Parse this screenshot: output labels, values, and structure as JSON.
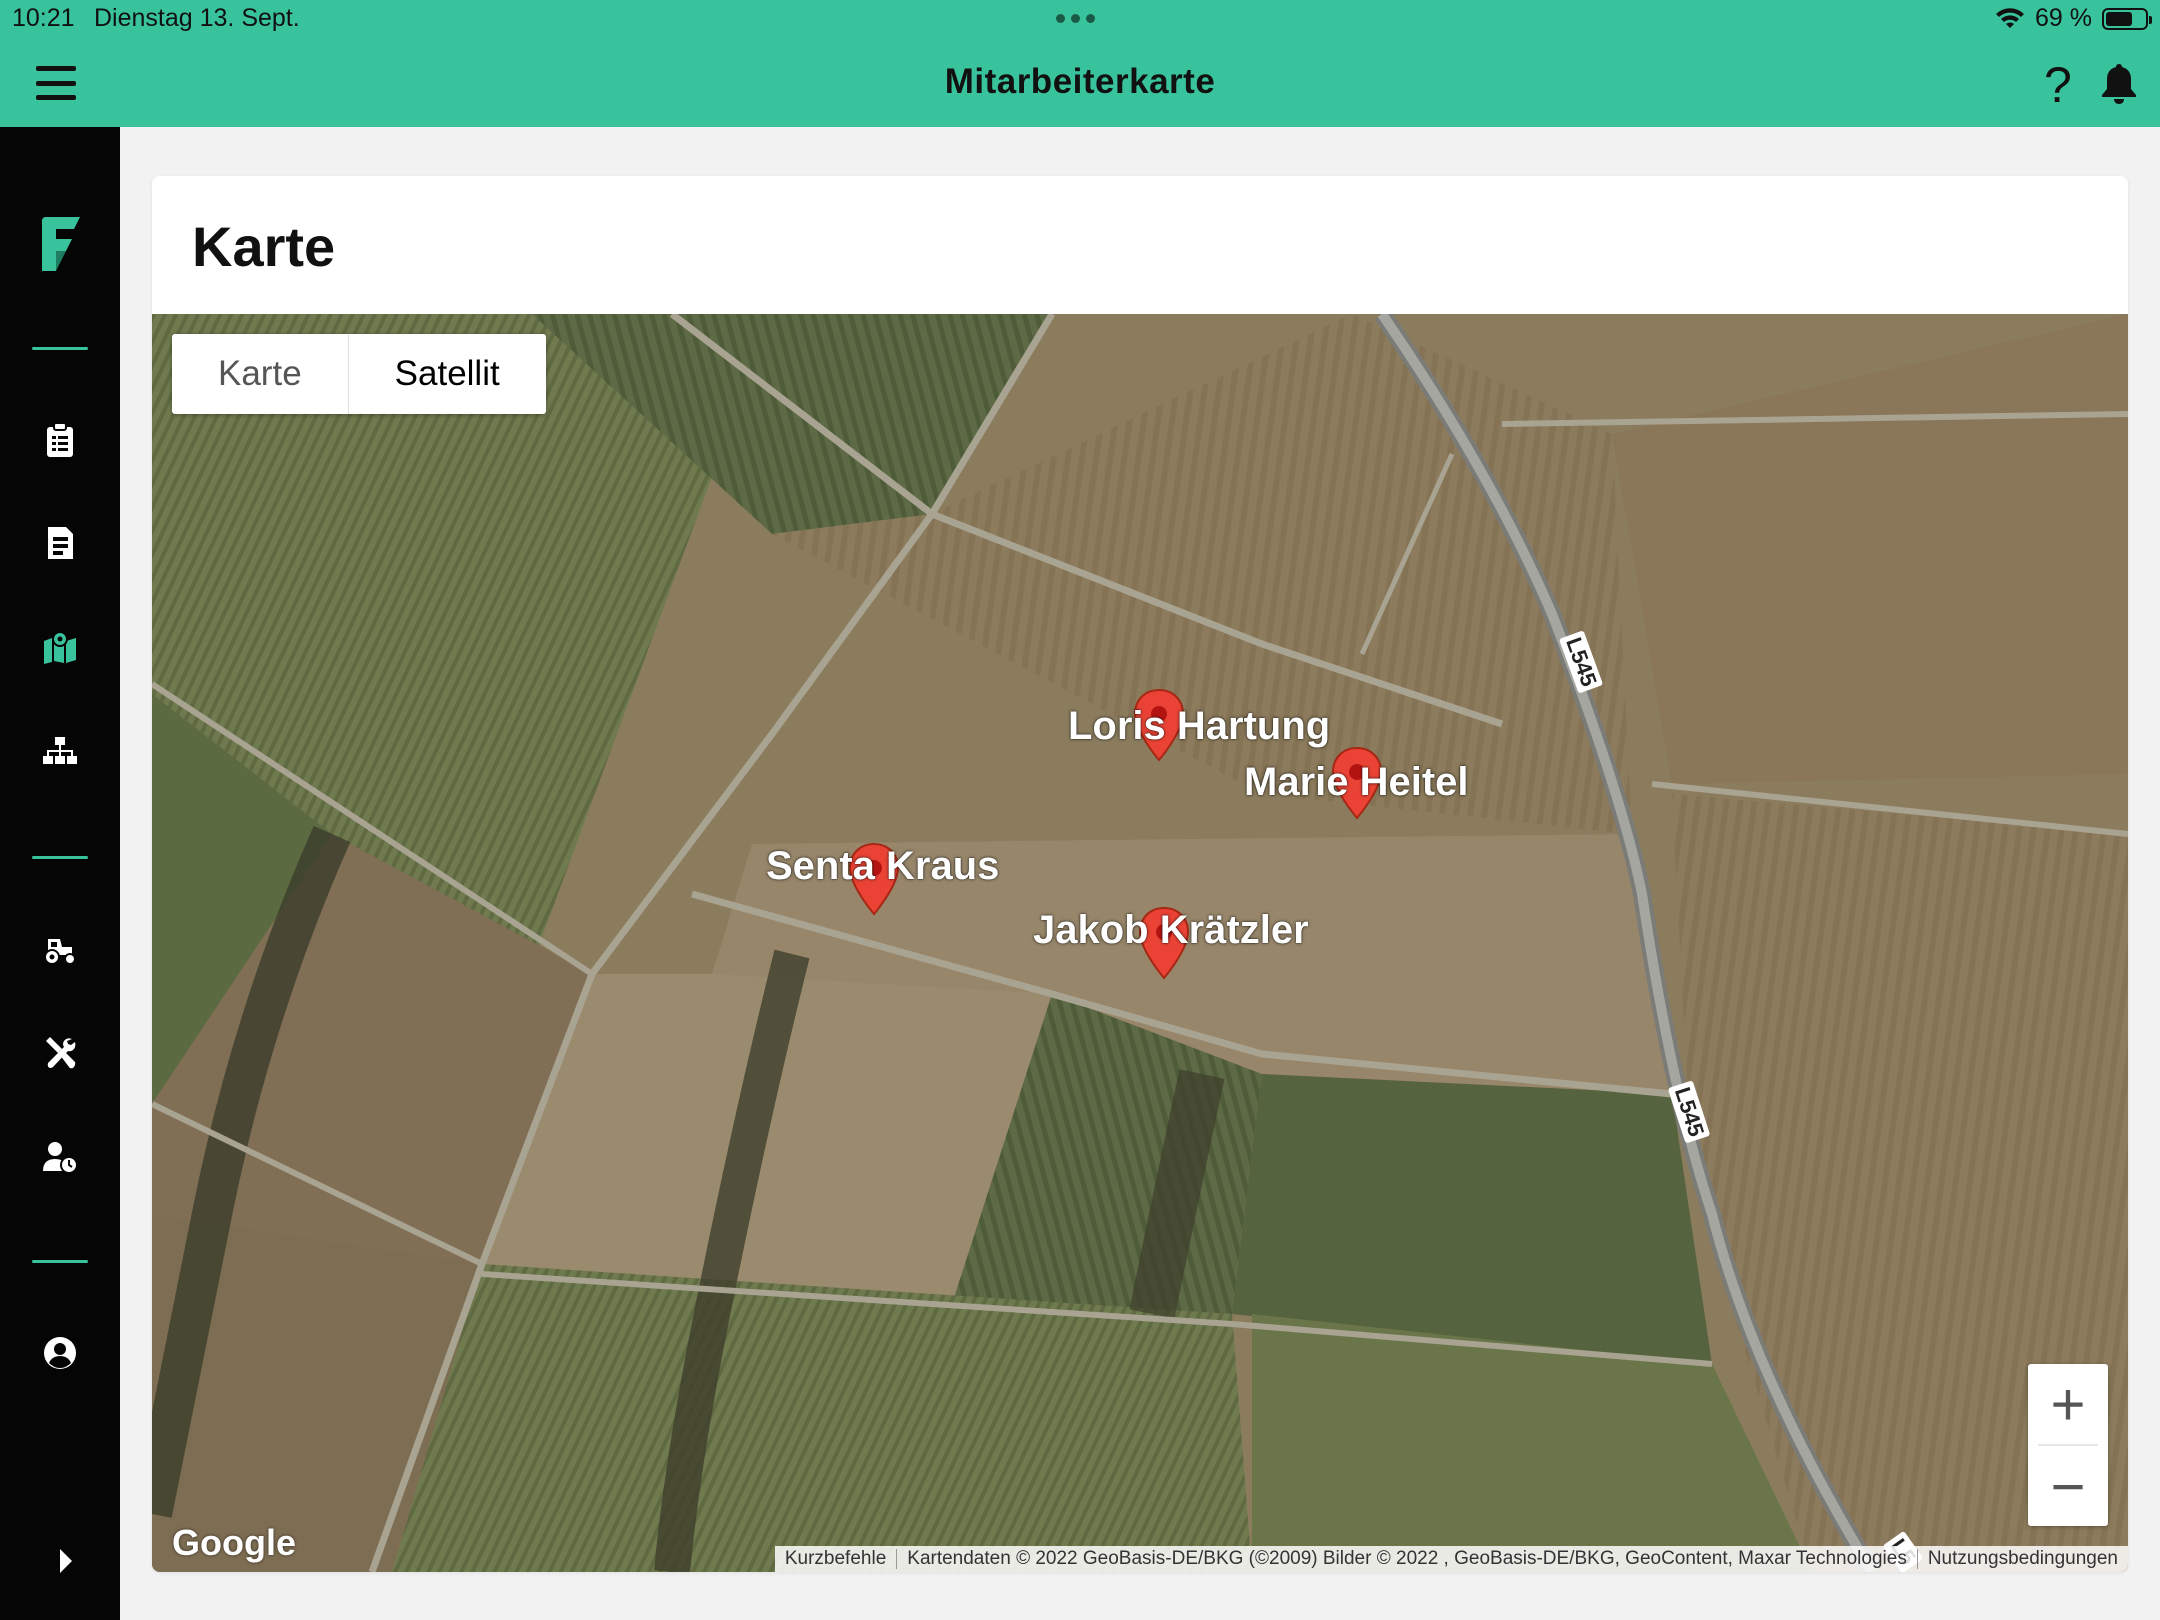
{
  "status_bar": {
    "time": "10:21",
    "date": "Dienstag 13. Sept.",
    "battery": "69 %",
    "battery_level": 0.69
  },
  "header": {
    "title": "Mitarbeiterkarte",
    "help_label": "?",
    "accent_color": "#38c39d"
  },
  "sidebar": {
    "icons": [
      "logo-icon",
      "clipboard-icon",
      "document-icon",
      "map-icon",
      "org-chart-icon",
      "tractor-icon",
      "tools-icon",
      "user-clock-icon",
      "account-icon",
      "chevron-right-icon"
    ]
  },
  "card": {
    "title": "Karte"
  },
  "map": {
    "type_options": [
      "Karte",
      "Satellit"
    ],
    "selected_type": "Satellit",
    "markers": [
      {
        "name": "Loris Hartung"
      },
      {
        "name": "Marie Heitel"
      },
      {
        "name": "Senta Kraus"
      },
      {
        "name": "Jakob Krätzler"
      }
    ],
    "road_labels": [
      "L545",
      "L545",
      "L5"
    ],
    "zoom_in": "+",
    "zoom_out": "−",
    "logo": "Google",
    "attribution": {
      "shortcuts": "Kurzbefehle",
      "data": "Kartendaten © 2022 GeoBasis-DE/BKG (©2009) Bilder © 2022 , GeoBasis-DE/BKG, GeoContent, Maxar Technologies",
      "terms": "Nutzungsbedingungen"
    }
  }
}
